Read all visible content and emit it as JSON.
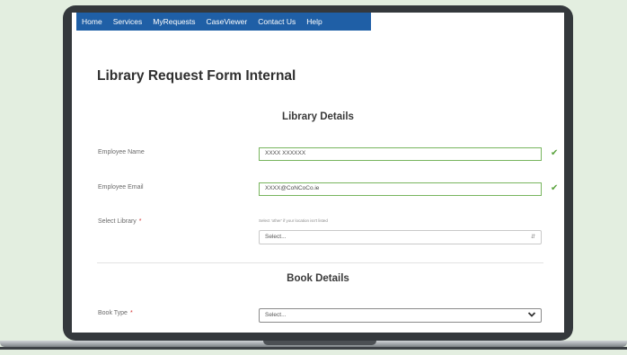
{
  "nav": {
    "items": [
      "Home",
      "Services",
      "MyRequests",
      "CaseViewer",
      "Contact Us",
      "Help"
    ]
  },
  "page": {
    "title": "Library Request Form Internal"
  },
  "library_details": {
    "heading": "Library Details",
    "employee_name": {
      "label": "Employee Name",
      "value": "XXXX XXXXXX",
      "valid_icon": "✔"
    },
    "employee_email": {
      "label": "Employee Email",
      "value": "XXXX@CoNCoCo.ie",
      "valid_icon": "✔"
    },
    "select_library": {
      "label": "Select Library",
      "required_mark": "*",
      "helper": "Select 'other' if your location isn't listed",
      "selected": "Select..."
    }
  },
  "book_details": {
    "heading": "Book Details",
    "book_type": {
      "label": "Book Type",
      "required_mark": "*",
      "selected": "Select..."
    }
  },
  "colors": {
    "nav_bg": "#1f5fa6",
    "valid_border": "#78b55e",
    "required": "#d43535",
    "check": "#5aa33d"
  }
}
